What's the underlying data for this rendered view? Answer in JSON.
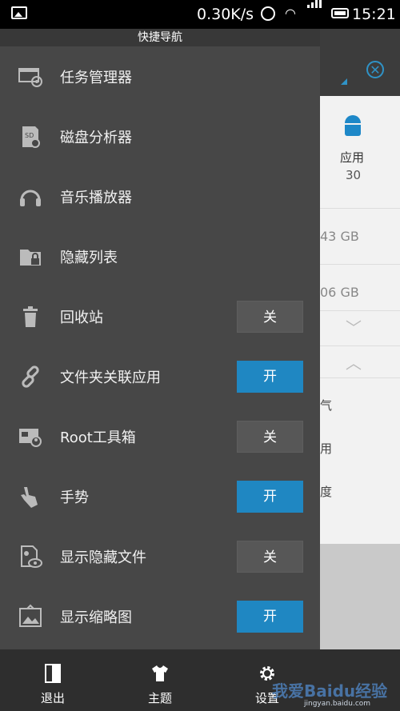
{
  "statusbar": {
    "speed": "0.30K/s",
    "time": "15:21"
  },
  "drawer": {
    "title": "快捷导航",
    "items": [
      {
        "label": "任务管理器",
        "icon": "task-manager-icon"
      },
      {
        "label": "磁盘分析器",
        "icon": "disk-analyzer-icon"
      },
      {
        "label": "音乐播放器",
        "icon": "headphones-icon"
      },
      {
        "label": "隐藏列表",
        "icon": "locked-folder-icon"
      },
      {
        "label": "回收站",
        "icon": "trash-icon",
        "toggle": "关",
        "on": false
      },
      {
        "label": "文件夹关联应用",
        "icon": "link-icon",
        "toggle": "开",
        "on": true
      },
      {
        "label": "Root工具箱",
        "icon": "root-toolbox-icon",
        "toggle": "关",
        "on": false
      },
      {
        "label": "手势",
        "icon": "hand-gesture-icon",
        "toggle": "开",
        "on": true
      },
      {
        "label": "显示隐藏文件",
        "icon": "hidden-file-icon",
        "toggle": "关",
        "on": false
      },
      {
        "label": "显示缩略图",
        "icon": "thumbnail-icon",
        "toggle": "开",
        "on": true
      }
    ]
  },
  "bottombar": {
    "exit": "退出",
    "theme": "主题",
    "settings": "设置"
  },
  "background": {
    "app_label": "应用",
    "app_count": "30",
    "gb1": "43 GB",
    "gb2": "06 GB",
    "t1": "气",
    "t2": "用",
    "t3": "度"
  },
  "watermark": {
    "text": "我爱Baidu经验",
    "url": "jingyan.baidu.com"
  },
  "colors": {
    "accent": "#1f87c2",
    "drawer_bg": "#474747",
    "toggle_off": "#575757"
  }
}
